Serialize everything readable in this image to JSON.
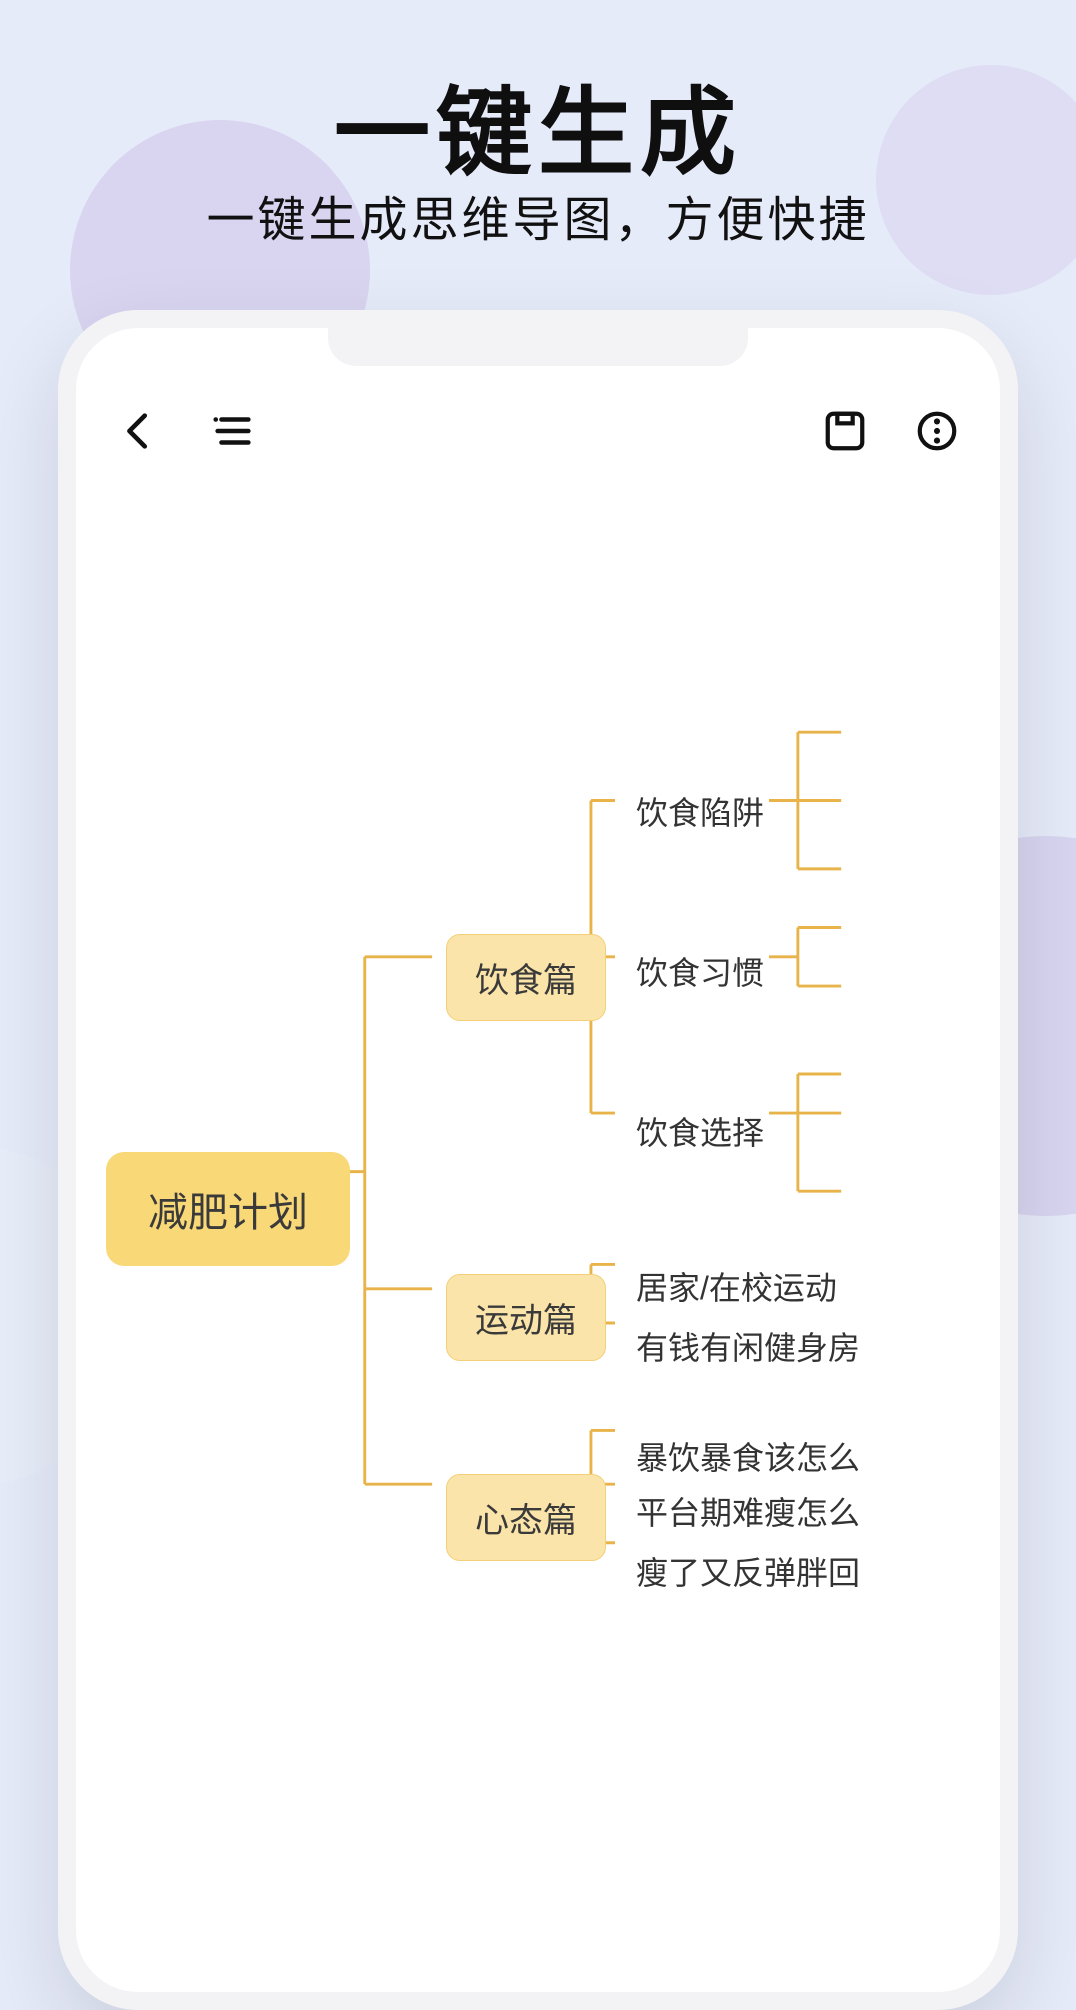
{
  "promo": {
    "headline": "一键生成",
    "subline": "一键生成思维导图，方便快捷"
  },
  "toolbar": {
    "back_icon": "back-icon",
    "outline_icon": "outline-icon",
    "save_icon": "save-icon",
    "more_icon": "more-icon"
  },
  "mindmap": {
    "root": "减肥计划",
    "branches": [
      {
        "label": "饮食篇",
        "children": [
          {
            "label": "饮食陷阱"
          },
          {
            "label": "饮食习惯"
          },
          {
            "label": "饮食选择"
          }
        ]
      },
      {
        "label": "运动篇",
        "children": [
          {
            "label": "居家/在校运动"
          },
          {
            "label": "有钱有闲健身房"
          }
        ]
      },
      {
        "label": "心态篇",
        "children": [
          {
            "label": "暴饮暴食该怎么"
          },
          {
            "label": "平台期难瘦怎么"
          },
          {
            "label": "瘦了又反弹胖回"
          }
        ]
      }
    ]
  },
  "colors": {
    "accent": "#e8b44a",
    "root_bg": "#f9d878",
    "branch_bg": "#fbe4a9",
    "page_bg": "#e6ebfa"
  }
}
